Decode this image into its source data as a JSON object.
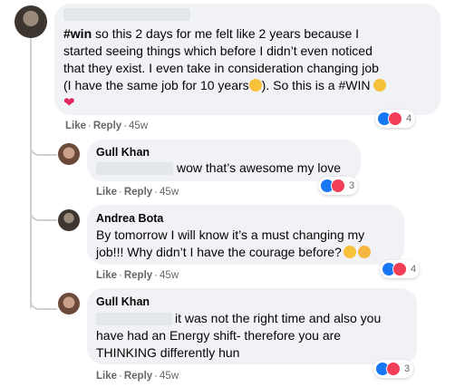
{
  "comments": [
    {
      "text_parts": [
        "#win",
        " so this 2 days for me felt like 2 years because I",
        "started seeing things which before I didn’t even noticed",
        "that they exist. I even take in consideration changing job",
        "(I have the same job for 10 years",
        "). So this is a #WIN"
      ],
      "like": "Like",
      "reply": "Reply",
      "time": "45w",
      "reactions": "4"
    },
    {
      "author": "Gull Khan",
      "text": "wow that’s awesome my love",
      "like": "Like",
      "reply": "Reply",
      "time": "45w",
      "reactions": "3"
    },
    {
      "author": "Andrea Bota",
      "lines": [
        "By tomorrow I will know it’s a must changing my",
        "job!!! Why didn’t I have the courage before?"
      ],
      "like": "Like",
      "reply": "Reply",
      "time": "45w",
      "reactions": "4"
    },
    {
      "author": "Gull Khan",
      "lines": [
        "it was not the right time and also you",
        "have had an Energy shift- therefore you are",
        "THINKING differently hun"
      ],
      "like": "Like",
      "reply": "Reply",
      "time": "45w",
      "reactions": "3"
    }
  ],
  "colors": {
    "bubble": "#f0f2f5",
    "like": "#1877f2",
    "love": "#f33e58",
    "meta": "#65676b"
  },
  "icons": [
    "like-reaction-icon",
    "love-reaction-icon",
    "heart-emoji",
    "smile-emoji",
    "cat-emoji"
  ]
}
